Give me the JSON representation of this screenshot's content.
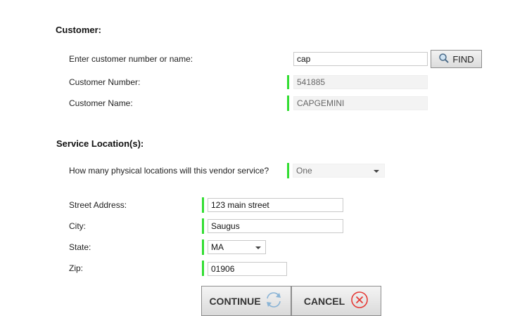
{
  "customer": {
    "section_title": "Customer:",
    "search_label": "Enter customer number or name:",
    "search_value": "cap",
    "find_label": "FIND",
    "number_label": "Customer Number:",
    "number_value": "541885",
    "name_label": "Customer Name:",
    "name_value": "CAPGEMINI"
  },
  "service": {
    "section_title": "Service Location(s):",
    "locations_question": "How many physical locations will this vendor service?",
    "locations_value": "One",
    "street_label": "Street Address:",
    "street_value": "123 main street",
    "city_label": "City:",
    "city_value": "Saugus",
    "state_label": "State:",
    "state_value": "MA",
    "zip_label": "Zip:",
    "zip_value": "01906"
  },
  "actions": {
    "continue_label": "CONTINUE",
    "cancel_label": "CANCEL"
  },
  "icons": {
    "find": "magnifier-icon",
    "continue": "refresh-icon",
    "cancel": "close-circle-icon"
  },
  "colors": {
    "required_bar": "#33dd33",
    "cancel_icon": "#e53935",
    "refresh_icon": "#8ab4d6"
  }
}
